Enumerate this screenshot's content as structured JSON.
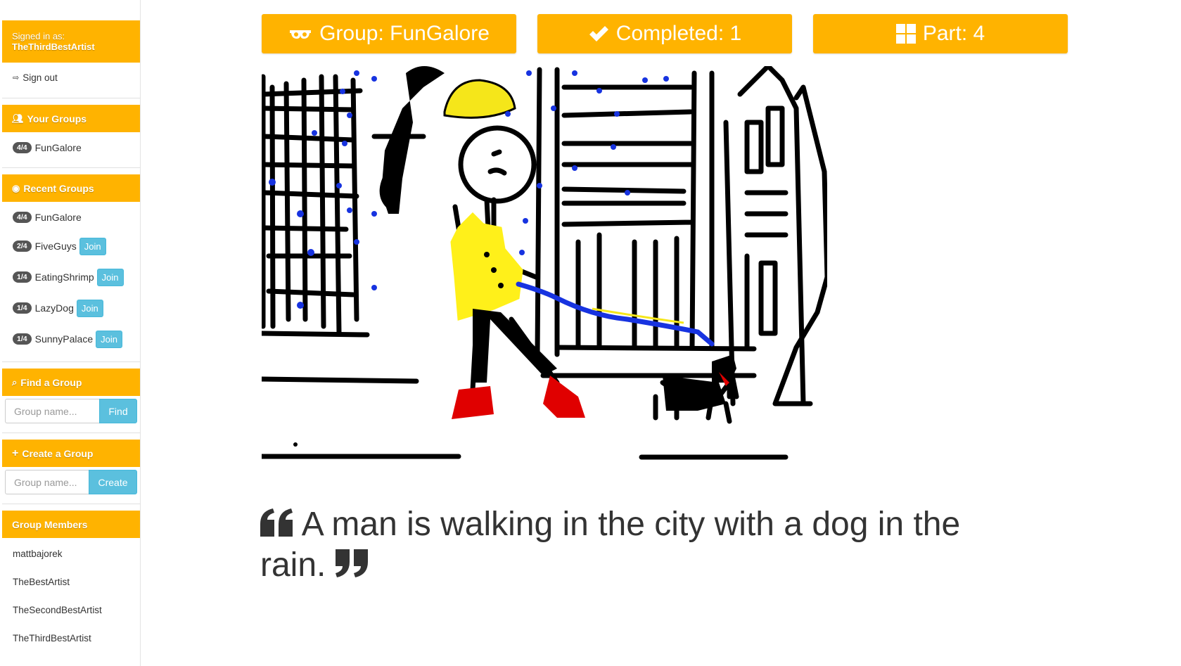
{
  "user": {
    "signed_in_label": "Signed in as:",
    "username": "TheThirdBestArtist",
    "sign_out": "Sign out"
  },
  "your_groups": {
    "title": "Your Groups",
    "items": [
      {
        "badge": "4/4",
        "name": "FunGalore"
      }
    ]
  },
  "recent_groups": {
    "title": "Recent Groups",
    "items": [
      {
        "badge": "4/4",
        "name": "FunGalore",
        "join": ""
      },
      {
        "badge": "2/4",
        "name": "FiveGuys",
        "join": "Join"
      },
      {
        "badge": "1/4",
        "name": "EatingShrimp",
        "join": "Join"
      },
      {
        "badge": "1/4",
        "name": "LazyDog",
        "join": "Join"
      },
      {
        "badge": "1/4",
        "name": "SunnyPalace",
        "join": "Join"
      }
    ]
  },
  "find_group": {
    "title": "Find a Group",
    "placeholder": "Group name...",
    "button": "Find"
  },
  "create_group": {
    "title": "Create a Group",
    "placeholder": "Group name...",
    "button": "Create"
  },
  "group_members": {
    "title": "Group Members",
    "items": [
      "mattbajorek",
      "TheBestArtist",
      "TheSecondBestArtist",
      "TheThirdBestArtist"
    ]
  },
  "stats": {
    "group": "Group: FunGalore",
    "completed": "Completed: 1",
    "part": "Part: 4"
  },
  "quote": {
    "text": "A man is walking in the city with a dog in the rain."
  },
  "colors": {
    "accent": "#FFB300",
    "info": "#5bc0de",
    "badge": "#555555"
  },
  "icons": [
    "sign-out-icon",
    "users-icon",
    "eye-icon",
    "search-icon",
    "plus-icon",
    "glasses-icon",
    "check-icon",
    "grid-icon",
    "quote-left-icon",
    "quote-right-icon"
  ]
}
